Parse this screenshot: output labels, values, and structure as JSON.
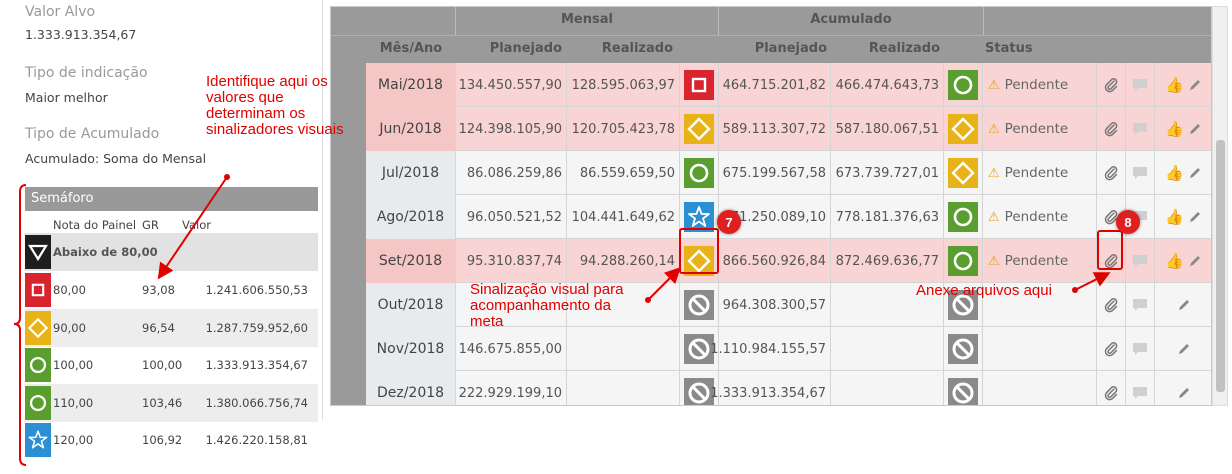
{
  "info": {
    "valor_alvo_label": "Valor Alvo",
    "valor_alvo_value": "1.333.913.354,67",
    "tipo_indicacao_label": "Tipo de indicação",
    "tipo_indicacao_value": "Maior melhor",
    "tipo_acumulado_label": "Tipo de Acumulado",
    "tipo_acumulado_value": "Acumulado: Soma do Mensal"
  },
  "semaforo": {
    "title": "Semáforo",
    "columns": [
      "Nota do Painel",
      "GR",
      "Valor"
    ],
    "below_label": "Abaixo de 80,00",
    "rows": [
      {
        "icon": "square-icon",
        "color": "#d9232d",
        "nota": "80,00",
        "gr": "93,08",
        "valor": "1.241.606.550,53"
      },
      {
        "icon": "diamond-icon",
        "color": "#e8b318",
        "nota": "90,00",
        "gr": "96,54",
        "valor": "1.287.759.952,60"
      },
      {
        "icon": "circle-icon",
        "color": "#5a9e2f",
        "nota": "100,00",
        "gr": "100,00",
        "valor": "1.333.913.354,67"
      },
      {
        "icon": "circle-icon",
        "color": "#5a9e2f",
        "nota": "110,00",
        "gr": "103,46",
        "valor": "1.380.066.756,74"
      },
      {
        "icon": "star-icon",
        "color": "#2b8fd4",
        "nota": "120,00",
        "gr": "106,92",
        "valor": "1.426.220.158,81"
      }
    ]
  },
  "table": {
    "group_mensal": "Mensal",
    "group_acumulado": "Acumulado",
    "col_mes": "Mês/Ano",
    "col_planejado": "Planejado",
    "col_realizado": "Realizado",
    "col_status": "Status",
    "rows": [
      {
        "month": "Mai/2018",
        "style": "pink",
        "m_plan": "134.450.557,90",
        "m_real": "128.595.063,97",
        "m_icon": "square",
        "a_plan": "464.715.201,82",
        "a_real": "466.474.643,73",
        "a_icon": "circle",
        "status": "Pendente",
        "likes": true
      },
      {
        "month": "Jun/2018",
        "style": "pink",
        "m_plan": "124.398.105,90",
        "m_real": "120.705.423,78",
        "m_icon": "diamond",
        "a_plan": "589.113.307,72",
        "a_real": "587.180.067,51",
        "a_icon": "diamond",
        "status": "Pendente",
        "likes": true
      },
      {
        "month": "Jul/2018",
        "style": "white",
        "m_plan": "86.086.259,86",
        "m_real": "86.559.659,50",
        "m_icon": "circle",
        "a_plan": "675.199.567,58",
        "a_real": "673.739.727,01",
        "a_icon": "diamond",
        "status": "Pendente",
        "likes": true
      },
      {
        "month": "Ago/2018",
        "style": "white",
        "m_plan": "96.050.521,52",
        "m_real": "104.441.649,62",
        "m_icon": "star",
        "a_plan": "771.250.089,10",
        "a_real": "778.181.376,63",
        "a_icon": "circle",
        "status": "Pendente",
        "likes": true
      },
      {
        "month": "Set/2018",
        "style": "pink",
        "m_plan": "95.310.837,74",
        "m_real": "94.288.260,14",
        "m_icon": "diamond",
        "a_plan": "866.560.926,84",
        "a_real": "872.469.636,77",
        "a_icon": "circle",
        "status": "Pendente",
        "likes": true
      },
      {
        "month": "Out/2018",
        "style": "white",
        "m_plan": "",
        "m_real": "",
        "m_icon": "ban",
        "a_plan": "964.308.300,57",
        "a_real": "",
        "a_icon": "ban",
        "status": "",
        "likes": false
      },
      {
        "month": "Nov/2018",
        "style": "white",
        "m_plan": "146.675.855,00",
        "m_real": "",
        "m_icon": "ban",
        "a_plan": "1.110.984.155,57",
        "a_real": "",
        "a_icon": "ban",
        "status": "",
        "likes": false
      },
      {
        "month": "Dez/2018",
        "style": "white",
        "m_plan": "222.929.199,10",
        "m_real": "",
        "m_icon": "ban",
        "a_plan": "1.333.913.354,67",
        "a_real": "",
        "a_icon": "ban",
        "status": "",
        "likes": false
      }
    ]
  },
  "colors": {
    "red": "#d9232d",
    "yellow": "#e8b318",
    "green": "#5a9e2f",
    "blue": "#2b8fd4",
    "gray": "#8a8a8a",
    "annotation": "#e00000"
  },
  "annotations": {
    "sinalizadores": "Identifique aqui os valores que determinam os sinalizadores visuais",
    "sinalizacao": "Sinalização visual para acompanhamento da meta",
    "anexe": "Anexe arquivos aqui",
    "badge7": "7",
    "badge8": "8"
  }
}
